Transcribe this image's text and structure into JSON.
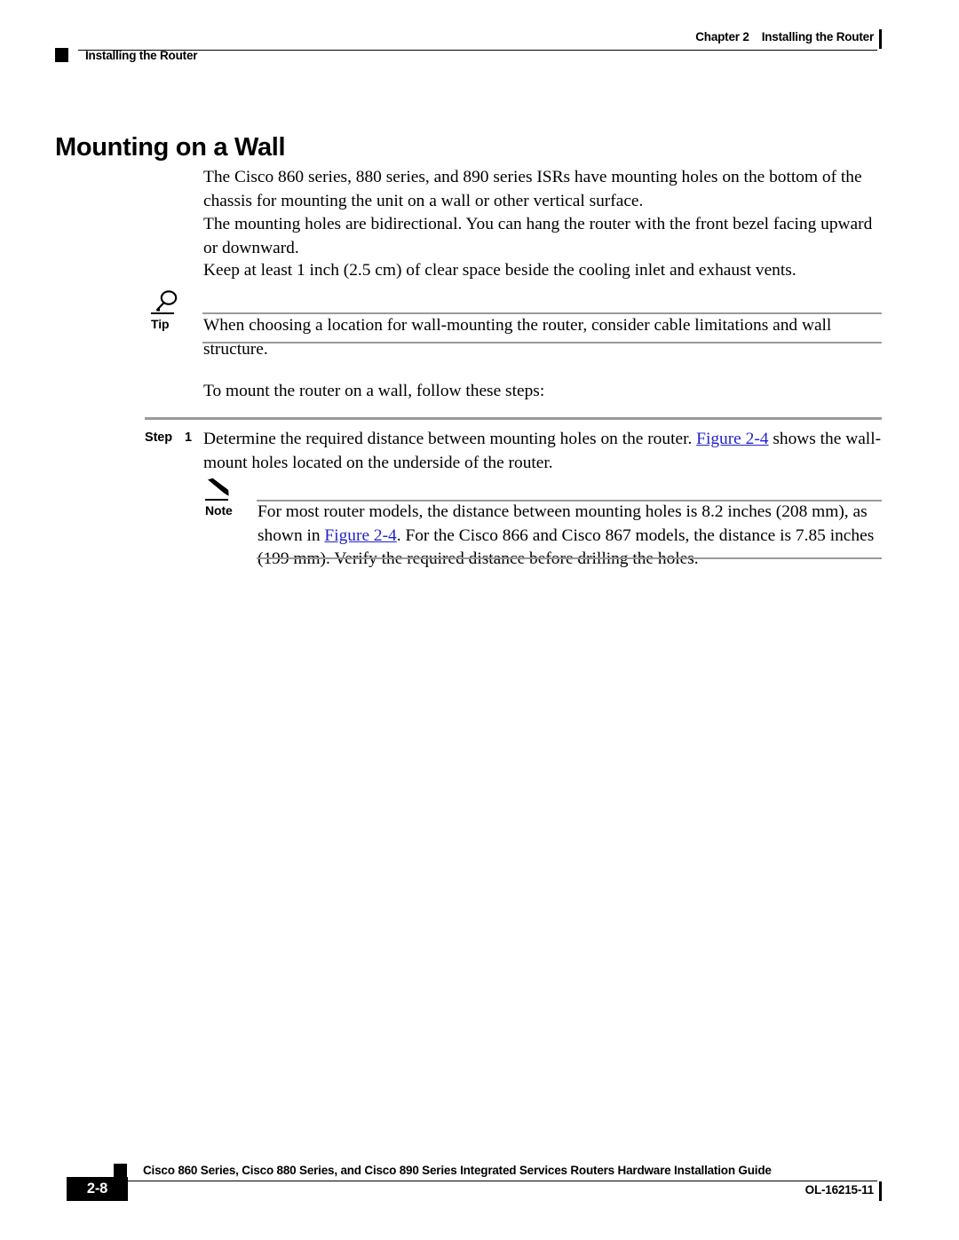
{
  "header": {
    "chapter_label": "Chapter 2",
    "chapter_title": "Installing the Router",
    "section_title": "Installing the Router"
  },
  "heading": {
    "title": "Mounting on a Wall"
  },
  "paragraphs": {
    "p1": "The Cisco 860 series, 880 series, and 890 series ISRs have mounting holes on the bottom of the chassis for mounting the unit on a wall or other vertical surface.",
    "p2": "The mounting holes are bidirectional. You can hang the router with the front bezel facing upward or downward.",
    "p3": "Keep at least 1 inch (2.5 cm) of clear space beside the cooling inlet and exhaust vents.",
    "p4": "To mount the router on a wall, follow these steps:"
  },
  "tip": {
    "label": "Tip",
    "icon": "magnifying-glass-icon",
    "text": "When choosing a location for wall-mounting the router, consider cable limitations and wall structure."
  },
  "step": {
    "label": "Step",
    "number": "1",
    "text_before_link": "Determine the required distance between mounting holes on the router. ",
    "link_text": "Figure 2-4",
    "text_after_link": " shows the wall-mount holes located on the underside of the router."
  },
  "note": {
    "label": "Note",
    "icon": "pencil-icon",
    "text_part1": "For most router models, the distance between mounting holes is 8.2 inches (208 mm), as shown in ",
    "link_text": "Figure 2-4",
    "text_part2": ". For the Cisco 866 and Cisco 867 models, the distance is 7.85 inches (199 mm). Verify the required distance before drilling the holes."
  },
  "footer": {
    "guide_title": "Cisco 860 Series, Cisco 880 Series, and Cisco 890 Series Integrated Services Routers Hardware Installation Guide",
    "page_number": "2-8",
    "doc_id": "OL-16215-11"
  }
}
